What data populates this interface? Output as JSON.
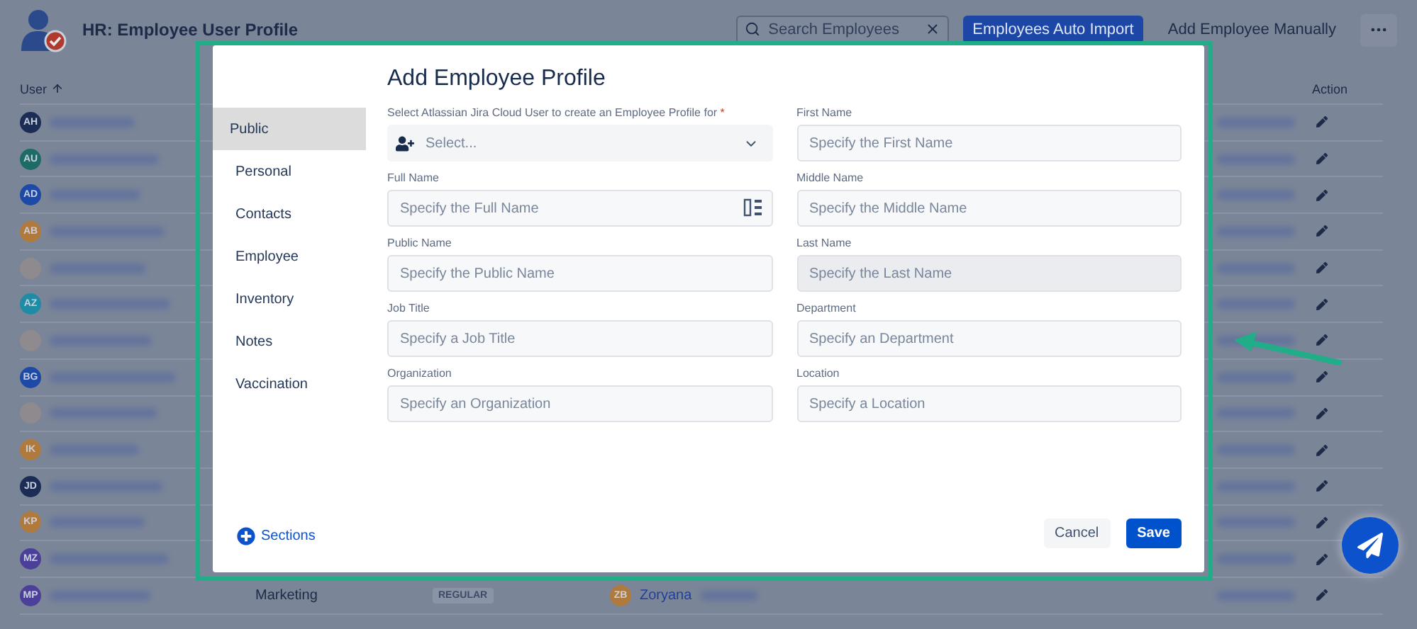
{
  "header": {
    "title": "HR: Employee User Profile",
    "search": {
      "placeholder": "Search Employees"
    },
    "buttons": [
      {
        "label": "Employees Auto Import",
        "kind": "primary"
      },
      {
        "label": "Add Employee Manually",
        "kind": "subtle"
      }
    ]
  },
  "table": {
    "columns": [
      {
        "label": "User",
        "sorted": true
      },
      {
        "label": "Action"
      }
    ],
    "rows": [
      {
        "kind": "initials",
        "initials": "AH",
        "color": "#1b2d55"
      },
      {
        "kind": "initials",
        "initials": "AU",
        "color": "#1c6b66"
      },
      {
        "kind": "initials",
        "initials": "AD",
        "color": "#1d4aa6"
      },
      {
        "kind": "initials",
        "initials": "AB",
        "color": "#b07a3c"
      },
      {
        "kind": "photo"
      },
      {
        "kind": "initials",
        "initials": "AZ",
        "color": "#1f8ca6"
      },
      {
        "kind": "photo"
      },
      {
        "kind": "initials",
        "initials": "BG",
        "color": "#1d4aa6"
      },
      {
        "kind": "photo"
      },
      {
        "kind": "initials",
        "initials": "IK",
        "color": "#b07a3c"
      },
      {
        "kind": "initials",
        "initials": "JD",
        "color": "#1b2d55"
      },
      {
        "kind": "initials",
        "initials": "KP",
        "color": "#b07a3c"
      },
      {
        "kind": "initials",
        "initials": "MZ",
        "color": "#4b3f99"
      },
      {
        "kind": "initials",
        "initials": "MP",
        "color": "#4b3f99",
        "department": "Marketing",
        "type": "REGULAR",
        "manager": {
          "initials": "ZB",
          "color": "#b07a3c",
          "name": "Zoryana"
        }
      }
    ]
  },
  "modal": {
    "title": "Add Employee Profile",
    "nav": {
      "items": [
        {
          "label": "Public",
          "selected": true
        },
        {
          "label": "Personal",
          "selected": false
        },
        {
          "label": "Contacts",
          "selected": false
        },
        {
          "label": "Employee",
          "selected": false
        },
        {
          "label": "Inventory",
          "selected": false
        },
        {
          "label": "Notes",
          "selected": false
        },
        {
          "label": "Vaccination",
          "selected": false
        }
      ],
      "add_button": "Sections"
    },
    "fields": [
      {
        "kind": "select",
        "label": "Select Atlassian Jira Cloud User to create an Employee Profile for",
        "required_mark": "*",
        "placeholder": "Select..."
      },
      {
        "kind": "text",
        "label": "First Name",
        "placeholder": "Specify the First Name",
        "disabled": false
      },
      {
        "kind": "text-icon",
        "label": "Full Name",
        "placeholder": "Specify the Full Name",
        "disabled": false
      },
      {
        "kind": "text",
        "label": "Middle Name",
        "placeholder": "Specify the Middle Name",
        "disabled": false
      },
      {
        "kind": "text",
        "label": "Public Name",
        "placeholder": "Specify the Public Name",
        "disabled": false
      },
      {
        "kind": "text",
        "label": "Last Name",
        "placeholder": "Specify the Last Name",
        "disabled": true
      },
      {
        "kind": "text",
        "label": "Job Title",
        "placeholder": "Specify a Job Title",
        "disabled": false
      },
      {
        "kind": "text",
        "label": "Department",
        "placeholder": "Specify an Department",
        "disabled": false
      },
      {
        "kind": "text",
        "label": "Organization",
        "placeholder": "Specify an Organization",
        "disabled": false
      },
      {
        "kind": "text",
        "label": "Location",
        "placeholder": "Specify a Location",
        "disabled": false
      }
    ],
    "buttons": [
      {
        "label": "Cancel",
        "kind": "subtle"
      },
      {
        "label": "Save",
        "kind": "primary"
      }
    ]
  }
}
